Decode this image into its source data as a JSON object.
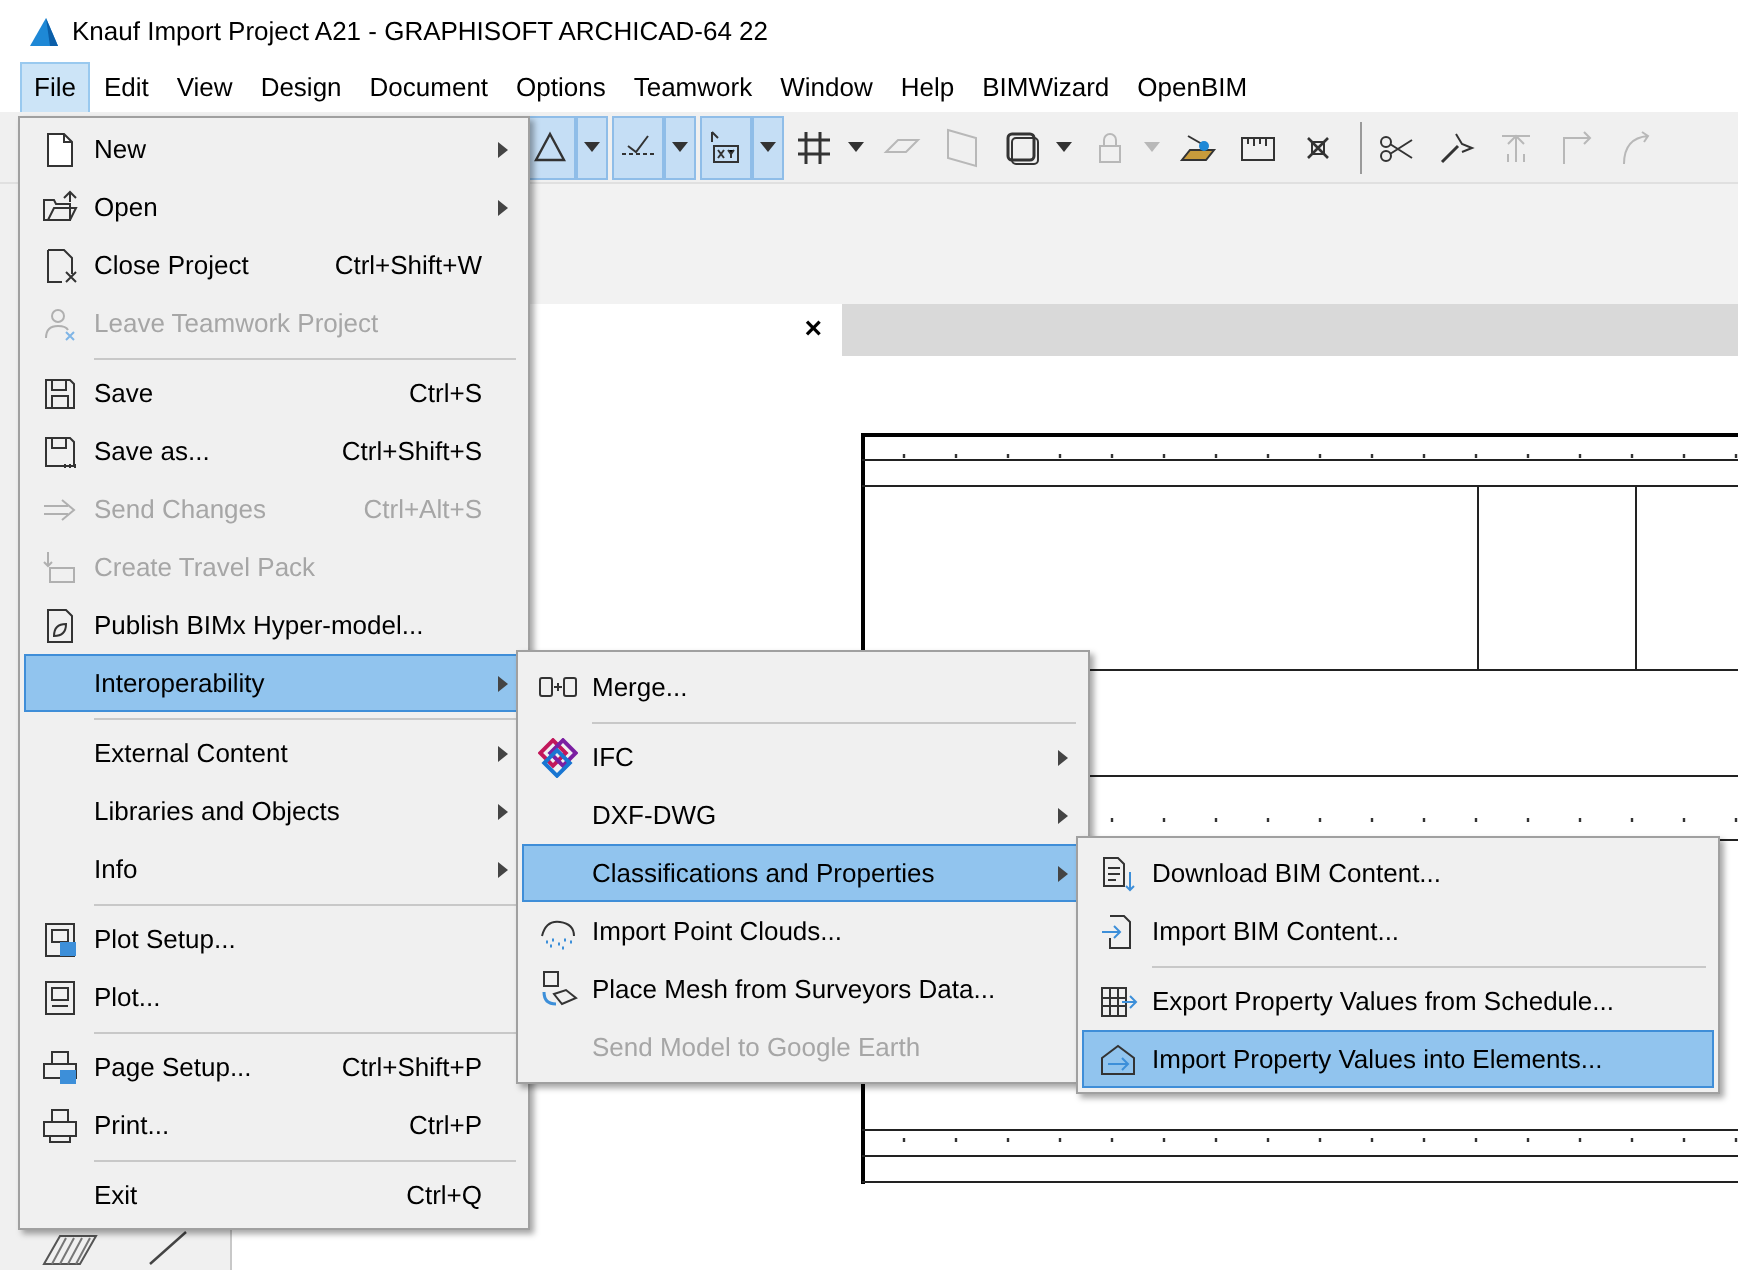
{
  "window": {
    "title": "Knauf Import Project A21 - GRAPHISOFT ARCHICAD-64 22"
  },
  "menu_bar": [
    {
      "label": "File",
      "selected": true
    },
    {
      "label": "Edit",
      "selected": false
    },
    {
      "label": "View",
      "selected": false
    },
    {
      "label": "Design",
      "selected": false
    },
    {
      "label": "Document",
      "selected": false
    },
    {
      "label": "Options",
      "selected": false
    },
    {
      "label": "Teamwork",
      "selected": false
    },
    {
      "label": "Window",
      "selected": false
    },
    {
      "label": "Help",
      "selected": false
    },
    {
      "label": "BIMWizard",
      "selected": false
    },
    {
      "label": "OpenBIM",
      "selected": false
    }
  ],
  "toolbar": [
    {
      "selected": true,
      "dropdown": true,
      "disabled": false
    },
    {
      "selected": true,
      "dropdown": true,
      "disabled": false
    },
    {
      "selected": true,
      "dropdown": true,
      "disabled": false
    },
    {
      "selected": false,
      "dropdown": true,
      "disabled": false
    },
    {
      "selected": false,
      "dropdown": false,
      "disabled": true
    },
    {
      "selected": false,
      "dropdown": false,
      "disabled": true
    },
    {
      "selected": false,
      "dropdown": true,
      "disabled": false
    },
    {
      "selected": false,
      "dropdown": true,
      "disabled": true
    },
    {
      "selected": false,
      "dropdown": false,
      "disabled": false
    },
    {
      "selected": false,
      "dropdown": false,
      "disabled": false
    },
    {
      "selected": false,
      "dropdown": false,
      "disabled": false
    },
    {
      "selected": false,
      "dropdown": false,
      "disabled": false
    },
    {
      "selected": false,
      "dropdown": false,
      "disabled": false
    },
    {
      "selected": false,
      "dropdown": false,
      "disabled": true
    },
    {
      "selected": false,
      "dropdown": false,
      "disabled": true
    },
    {
      "selected": false,
      "dropdown": false,
      "disabled": true
    }
  ],
  "document_tab": {
    "close": "×"
  },
  "file_menu": {
    "items": [
      {
        "kind": "item",
        "label": "New",
        "submenu": true,
        "disabled": false,
        "selected": false
      },
      {
        "kind": "item",
        "label": "Open",
        "submenu": true,
        "disabled": false,
        "selected": false
      },
      {
        "kind": "item",
        "label": "Close Project",
        "shortcut": "Ctrl+Shift+W",
        "submenu": false,
        "disabled": false,
        "selected": false
      },
      {
        "kind": "item",
        "label": "Leave Teamwork Project",
        "submenu": false,
        "disabled": true,
        "selected": false
      },
      {
        "kind": "separator"
      },
      {
        "kind": "item",
        "label": "Save",
        "shortcut": "Ctrl+S",
        "submenu": false,
        "disabled": false,
        "selected": false
      },
      {
        "kind": "item",
        "label": "Save as...",
        "shortcut": "Ctrl+Shift+S",
        "submenu": false,
        "disabled": false,
        "selected": false
      },
      {
        "kind": "item",
        "label": "Send Changes",
        "shortcut": "Ctrl+Alt+S",
        "submenu": false,
        "disabled": true,
        "selected": false
      },
      {
        "kind": "item",
        "label": "Create Travel Pack",
        "submenu": false,
        "disabled": true,
        "selected": false
      },
      {
        "kind": "item",
        "label": "Publish BIMx Hyper-model...",
        "submenu": false,
        "disabled": false,
        "selected": false
      },
      {
        "kind": "item",
        "label": "Interoperability",
        "submenu": true,
        "disabled": false,
        "selected": true
      },
      {
        "kind": "separator"
      },
      {
        "kind": "item",
        "label": "External Content",
        "submenu": true,
        "disabled": false,
        "selected": false
      },
      {
        "kind": "item",
        "label": "Libraries and Objects",
        "submenu": true,
        "disabled": false,
        "selected": false
      },
      {
        "kind": "item",
        "label": "Info",
        "submenu": true,
        "disabled": false,
        "selected": false
      },
      {
        "kind": "separator"
      },
      {
        "kind": "item",
        "label": "Plot Setup...",
        "submenu": false,
        "disabled": false,
        "selected": false
      },
      {
        "kind": "item",
        "label": "Plot...",
        "submenu": false,
        "disabled": false,
        "selected": false
      },
      {
        "kind": "separator"
      },
      {
        "kind": "item",
        "label": "Page Setup...",
        "shortcut": "Ctrl+Shift+P",
        "submenu": false,
        "disabled": false,
        "selected": false
      },
      {
        "kind": "item",
        "label": "Print...",
        "shortcut": "Ctrl+P",
        "submenu": false,
        "disabled": false,
        "selected": false
      },
      {
        "kind": "separator"
      },
      {
        "kind": "item",
        "label": "Exit",
        "shortcut": "Ctrl+Q",
        "submenu": false,
        "disabled": false,
        "selected": false
      }
    ]
  },
  "interoperability_submenu": {
    "items": [
      {
        "kind": "item",
        "label": "Merge...",
        "submenu": false,
        "disabled": false,
        "selected": false
      },
      {
        "kind": "separator"
      },
      {
        "kind": "item",
        "label": "IFC",
        "submenu": true,
        "disabled": false,
        "selected": false
      },
      {
        "kind": "item",
        "label": "DXF-DWG",
        "submenu": true,
        "disabled": false,
        "selected": false
      },
      {
        "kind": "item",
        "label": "Classifications and Properties",
        "submenu": true,
        "disabled": false,
        "selected": true
      },
      {
        "kind": "item",
        "label": "Import Point Clouds...",
        "submenu": false,
        "disabled": false,
        "selected": false
      },
      {
        "kind": "item",
        "label": "Place Mesh from Surveyors Data...",
        "submenu": false,
        "disabled": false,
        "selected": false
      },
      {
        "kind": "item",
        "label": "Send Model to Google Earth",
        "submenu": false,
        "disabled": true,
        "selected": false
      }
    ]
  },
  "classifications_submenu": {
    "items": [
      {
        "kind": "item",
        "label": "Download BIM Content...",
        "submenu": false,
        "disabled": false,
        "selected": false
      },
      {
        "kind": "item",
        "label": "Import BIM Content...",
        "submenu": false,
        "disabled": false,
        "selected": false
      },
      {
        "kind": "separator"
      },
      {
        "kind": "item",
        "label": "Export Property Values from Schedule...",
        "submenu": false,
        "disabled": false,
        "selected": false
      },
      {
        "kind": "item",
        "label": "Import Property Values into Elements...",
        "submenu": false,
        "disabled": false,
        "selected": true
      }
    ]
  }
}
